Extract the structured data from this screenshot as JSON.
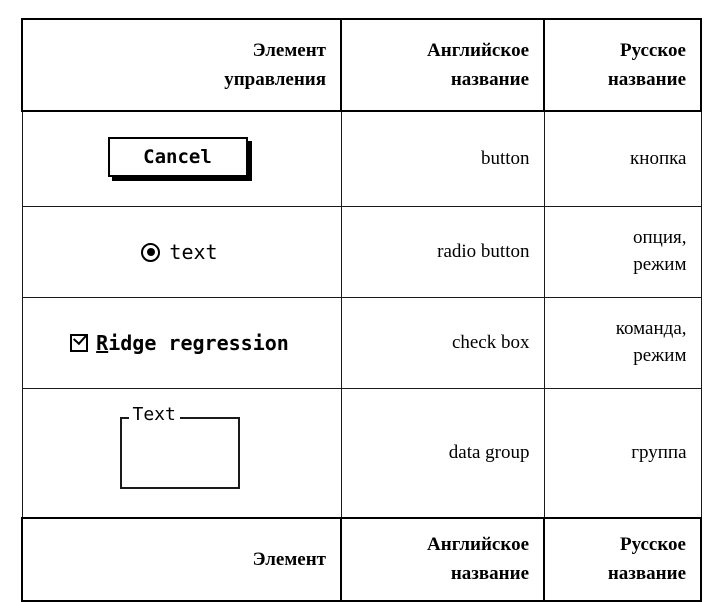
{
  "table": {
    "columns": [
      "Элемент управления",
      "Английское название",
      "Русское название"
    ],
    "header_top": {
      "control_line1": "Элемент",
      "control_line2": "управления",
      "english_line1": "Английское",
      "english_line2": "название",
      "russian_line1": "Русское",
      "russian_line2": "название"
    },
    "header_bottom": {
      "control_line1": "Элемент",
      "english_line1": "Английское",
      "english_line2": "название",
      "russian_line1": "Русское",
      "russian_line2": "название"
    },
    "rows": [
      {
        "control_kind": "button",
        "control_label": "Cancel",
        "english": "button",
        "russian": "кнопка"
      },
      {
        "control_kind": "radio-button",
        "control_label": "text",
        "english": "radio button",
        "russian_line1": "опция,",
        "russian_line2": "режим"
      },
      {
        "control_kind": "check-box",
        "control_accel": "R",
        "control_label_rest": "idge regression",
        "english": "check box",
        "russian_line1": "команда,",
        "russian_line2": "режим"
      },
      {
        "control_kind": "data-group",
        "control_label": "Text",
        "english": "data group",
        "russian": "группа"
      }
    ]
  },
  "colors": {
    "border": "#1a1a1a",
    "header_border": "#000000",
    "text": "#000000",
    "background": "#ffffff"
  }
}
